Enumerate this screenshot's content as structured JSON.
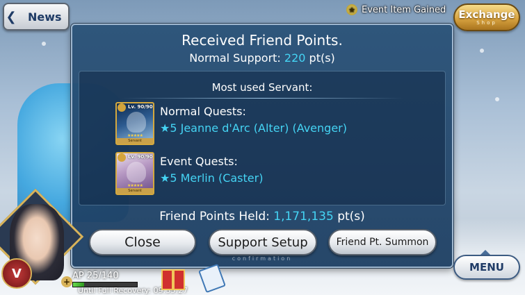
{
  "header": {
    "news_label": "News",
    "event_item_gained": "Event Item Gained",
    "exchange": {
      "label": "Exchange",
      "sub": "Shop"
    }
  },
  "dialog": {
    "title": "Received Friend Points.",
    "support_prefix": "Normal Support: ",
    "support_points": "220",
    "support_unit": " pt(s)",
    "most_used_heading": "Most used Servant:",
    "quests": [
      {
        "label": "Normal Quests:",
        "servant": "★5  Jeanne d'Arc (Alter) (Avenger)",
        "card_level": "Lv. 90/90",
        "card_stars": "★★★★★",
        "card_name": "Servant"
      },
      {
        "label": "Event Quests:",
        "servant": "★5  Merlin (Caster)",
        "card_level": "Lv. 90/90",
        "card_stars": "★★★★★",
        "card_name": "Servant"
      }
    ],
    "held_prefix": "Friend Points Held: ",
    "held_points": "1,171,135",
    "held_unit": " pt(s)",
    "buttons": {
      "close": "Close",
      "support_setup": "Support Setup",
      "friend_summon": "Friend Pt. Summon"
    },
    "confirmation": "confirmation"
  },
  "player": {
    "emblem": "V",
    "ap_text": "AP 25/140",
    "ap_fraction": 0.179,
    "recovery_text": "Until Full Recovery: 09:35:27"
  },
  "menu_label": "MENU",
  "colors": {
    "accent_cyan": "#45d4f4",
    "dialog_bg": "#1c3e62",
    "exchange_gold": "#d9a441"
  },
  "icons": [
    "chevron-left-icon",
    "event-star-icon",
    "gift-icon",
    "clipboard-icon",
    "plus-icon",
    "up-arrow-icon"
  ]
}
